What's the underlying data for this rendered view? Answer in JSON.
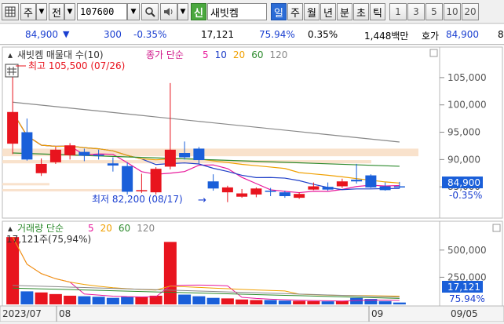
{
  "toolbar": {
    "market_btn": "주",
    "period_btn": "전",
    "code": "107600",
    "new_btn": "신",
    "stock_name": "새빗켐",
    "periods": [
      "일",
      "주",
      "월",
      "년",
      "분",
      "초",
      "틱"
    ],
    "active_period": "일",
    "intervals": [
      "1",
      "3",
      "5",
      "10",
      "20"
    ]
  },
  "infobar": {
    "price": "84,900",
    "change": "300",
    "change_pct": "-0.35%",
    "volume": "17,121",
    "turnover_pct": "75.94%",
    "ratio": "0.35%",
    "amount": "1,448백만",
    "quote_label": "호가",
    "quote_price": "84,900",
    "quote_next": "8"
  },
  "price_panel": {
    "title": "새빗켐 매물대 수(10)",
    "ma_label": "종가 단순",
    "ma_periods": [
      "5",
      "10",
      "20",
      "60",
      "120"
    ],
    "high_label": "최고 105,500 (07/26)",
    "low_label": "최저 82,200 (08/17)",
    "y_ticks": [
      "105,000",
      "100,000",
      "95,000",
      "90,000",
      "85,000"
    ],
    "last_price": "84,900",
    "last_change": "-0.35%"
  },
  "volume_panel": {
    "title": "거래량 단순",
    "ma_periods": [
      "5",
      "20",
      "60",
      "120"
    ],
    "current_label": "17,121주(75,94%)",
    "y_ticks": [
      "500,000",
      "250,000"
    ],
    "last_volume": "17,121",
    "last_pct": "75.94%"
  },
  "x_axis": {
    "left_label": "2023/07",
    "month_labels": [
      "08",
      "09"
    ],
    "right_label": "09/05"
  },
  "colors": {
    "up": "#e8141e",
    "down": "#1a5fd9",
    "ma5": "#e8189b",
    "ma10": "#1f3fc8",
    "ma20": "#f0a000",
    "ma60": "#2e8b2e",
    "ma120": "#888888",
    "highlight": "#1a3fd0"
  },
  "chart_data": {
    "type": "candlestick",
    "candles": [
      {
        "o": 92900,
        "h": 105500,
        "l": 91000,
        "c": 98700
      },
      {
        "o": 95000,
        "h": 97500,
        "l": 89800,
        "c": 90000
      },
      {
        "o": 87500,
        "h": 90200,
        "l": 87000,
        "c": 89200
      },
      {
        "o": 89500,
        "h": 92300,
        "l": 89200,
        "c": 91800
      },
      {
        "o": 90800,
        "h": 93000,
        "l": 90000,
        "c": 92600
      },
      {
        "o": 91400,
        "h": 92000,
        "l": 89700,
        "c": 90700
      },
      {
        "o": 90900,
        "h": 91800,
        "l": 90000,
        "c": 90800
      },
      {
        "o": 89300,
        "h": 90400,
        "l": 87800,
        "c": 88900
      },
      {
        "o": 88800,
        "h": 89500,
        "l": 83600,
        "c": 84100
      },
      {
        "o": 84200,
        "h": 87400,
        "l": 83900,
        "c": 84400
      },
      {
        "o": 84000,
        "h": 88600,
        "l": 83600,
        "c": 88300
      },
      {
        "o": 88700,
        "h": 104000,
        "l": 88200,
        "c": 91800
      },
      {
        "o": 91200,
        "h": 93300,
        "l": 90000,
        "c": 90400
      },
      {
        "o": 92000,
        "h": 92300,
        "l": 89200,
        "c": 89900
      },
      {
        "o": 86000,
        "h": 87300,
        "l": 84300,
        "c": 84700
      },
      {
        "o": 84000,
        "h": 85200,
        "l": 82200,
        "c": 84900
      },
      {
        "o": 83200,
        "h": 84600,
        "l": 83000,
        "c": 83800
      },
      {
        "o": 83600,
        "h": 84900,
        "l": 83100,
        "c": 84700
      },
      {
        "o": 84300,
        "h": 84800,
        "l": 83300,
        "c": 84200
      },
      {
        "o": 84000,
        "h": 84300,
        "l": 83000,
        "c": 83300
      },
      {
        "o": 83000,
        "h": 84000,
        "l": 82800,
        "c": 83700
      },
      {
        "o": 84500,
        "h": 85800,
        "l": 84400,
        "c": 85100
      },
      {
        "o": 85000,
        "h": 85800,
        "l": 84300,
        "c": 84500
      },
      {
        "o": 85100,
        "h": 86500,
        "l": 84800,
        "c": 86000
      },
      {
        "o": 86300,
        "h": 89200,
        "l": 85600,
        "c": 86000
      },
      {
        "o": 87100,
        "h": 87300,
        "l": 84800,
        "c": 84900
      },
      {
        "o": 85100,
        "h": 85800,
        "l": 84300,
        "c": 84400
      },
      {
        "o": 85100,
        "h": 85900,
        "l": 84700,
        "c": 84900
      }
    ],
    "volumes": [
      620000,
      120000,
      110000,
      95000,
      80000,
      75000,
      70000,
      60000,
      70000,
      70000,
      80000,
      575000,
      90000,
      75000,
      60000,
      55000,
      45000,
      40000,
      40000,
      35000,
      32000,
      30000,
      28000,
      30000,
      60000,
      50000,
      30000,
      17121
    ],
    "y_range": [
      80000,
      108000
    ],
    "vol_range": [
      0,
      650000
    ]
  }
}
